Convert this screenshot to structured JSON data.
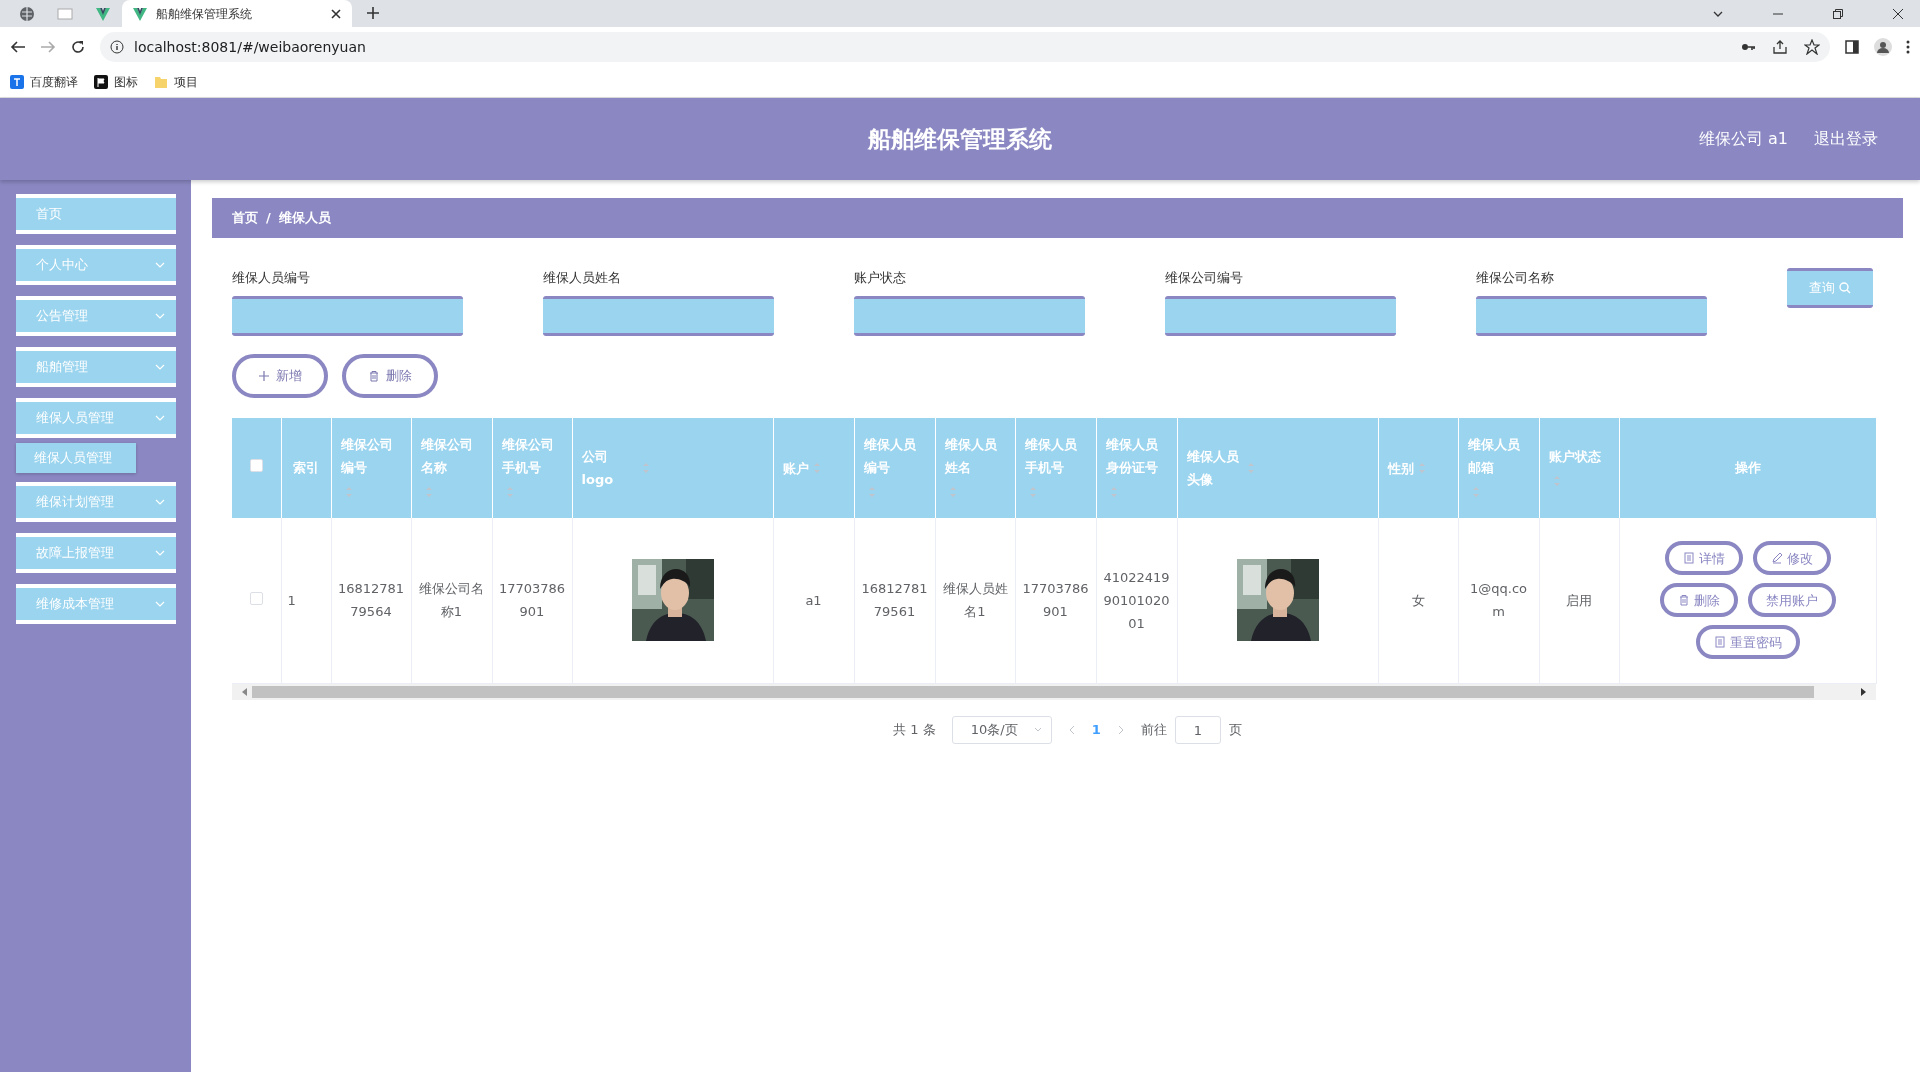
{
  "browser": {
    "tabs": [
      {
        "kind": "pinned",
        "selected": false
      },
      {
        "kind": "pinned",
        "selected": false
      },
      {
        "kind": "pinned",
        "selected": false
      },
      {
        "kind": "page",
        "title": "船舶维保管理系统",
        "selected": true
      }
    ],
    "address": "localhost:8081/#/weibaorenyuan",
    "bookmarks": [
      {
        "label": "百度翻译"
      },
      {
        "label": "图标"
      },
      {
        "label": "项目"
      }
    ]
  },
  "header": {
    "title": "船舶维保管理系统",
    "user": "维保公司 a1",
    "logout": "退出登录"
  },
  "sidebar": {
    "items": [
      {
        "label": "首页",
        "kind": "link"
      },
      {
        "label": "个人中心",
        "kind": "menu"
      },
      {
        "label": "公告管理",
        "kind": "menu"
      },
      {
        "label": "船舶管理",
        "kind": "menu"
      },
      {
        "label": "维保人员管理",
        "kind": "menu",
        "children": [
          {
            "label": "维保人员管理"
          }
        ]
      },
      {
        "label": "维保计划管理",
        "kind": "menu"
      },
      {
        "label": "故障上报管理",
        "kind": "menu"
      },
      {
        "label": "维修成本管理",
        "kind": "menu"
      }
    ]
  },
  "breadcrumbs": {
    "items": [
      "首页",
      "维保人员"
    ],
    "separator": "/"
  },
  "search": {
    "fields": [
      {
        "label": "维保人员编号"
      },
      {
        "label": "维保人员姓名"
      },
      {
        "label": "账户状态"
      },
      {
        "label": "维保公司编号"
      },
      {
        "label": "维保公司名称"
      }
    ],
    "query_button": "查询"
  },
  "actions": [
    "新增",
    "删除"
  ],
  "table": {
    "select_all_checked": false,
    "columns": [
      {
        "label": "索引",
        "sortable": false
      },
      {
        "label": "维保公司编号",
        "sortable": true
      },
      {
        "label": "维保公司名称",
        "sortable": true
      },
      {
        "label": "维保公司手机号",
        "sortable": true
      },
      {
        "label": "公司logo",
        "sortable": true
      },
      {
        "label": "账户",
        "sortable": true
      },
      {
        "label": "维保人员编号",
        "sortable": true
      },
      {
        "label": "维保人员姓名",
        "sortable": true
      },
      {
        "label": "维保人员手机号",
        "sortable": true
      },
      {
        "label": "维保人员身份证号",
        "sortable": true
      },
      {
        "label": "维保人员头像",
        "sortable": true
      },
      {
        "label": "性别",
        "sortable": true
      },
      {
        "label": "维保人员邮箱",
        "sortable": true
      },
      {
        "label": "账户状态",
        "sortable": true
      },
      {
        "label": "操作",
        "sortable": false
      }
    ],
    "rows": [
      {
        "checked": false,
        "cells": [
          {
            "kind": "text",
            "text": "1"
          },
          {
            "kind": "text",
            "text": "1681278179564"
          },
          {
            "kind": "text",
            "text": "维保公司名称1"
          },
          {
            "kind": "text",
            "text": "17703786901"
          },
          {
            "kind": "picture"
          },
          {
            "kind": "text",
            "text": "a1"
          },
          {
            "kind": "text",
            "text": "1681278179561"
          },
          {
            "kind": "text",
            "text": "维保人员姓名1"
          },
          {
            "kind": "text",
            "text": "17703786901"
          },
          {
            "kind": "text",
            "text": "410224199010102001"
          },
          {
            "kind": "picture"
          },
          {
            "kind": "text",
            "text": "女"
          },
          {
            "kind": "text",
            "text": "1@qq.com"
          },
          {
            "kind": "text",
            "text": "启用"
          },
          {
            "kind": "actions",
            "buttons": [
              "详情",
              "修改",
              "删除",
              "禁用账户",
              "重置密码"
            ]
          }
        ]
      }
    ]
  },
  "pagination": {
    "total": "共 1 条",
    "page_size": "10条/页",
    "pages": [
      {
        "label": "1",
        "selected": true
      }
    ],
    "goto_label": "前往",
    "goto_value": "1",
    "goto_suffix": "页"
  }
}
